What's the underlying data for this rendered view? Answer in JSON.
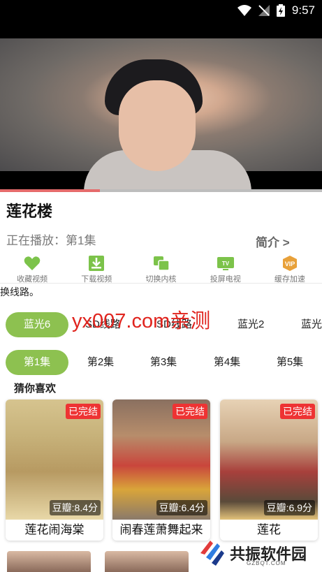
{
  "status": {
    "time": "9:57"
  },
  "player": {
    "progress": 0.31
  },
  "title": "莲花楼",
  "now_playing": "正在播放：第1集",
  "intro": "简介 >",
  "actions": [
    {
      "label": "收藏视频",
      "icon": "heart-icon"
    },
    {
      "label": "下载视频",
      "icon": "download-icon"
    },
    {
      "label": "切换内核",
      "icon": "switch-core-icon"
    },
    {
      "label": "投屏电视",
      "icon": "tv-icon"
    },
    {
      "label": "缓存加速",
      "icon": "vip-icon"
    }
  ],
  "marquee": "换线路。",
  "lines": [
    "蓝光6",
    "SD线路",
    "SD线路",
    "蓝光2",
    "蓝光"
  ],
  "watermark": "yx007.com亲测",
  "episodes": [
    "第1集",
    "第2集",
    "第3集",
    "第4集",
    "第5集"
  ],
  "section_title": "猜你喜欢",
  "recommendations": [
    {
      "name": "莲花闹海棠",
      "badge": "已完结",
      "score": "豆瓣:8.4分"
    },
    {
      "name": "闹春莲萧舞起来",
      "badge": "已完结",
      "score": "豆瓣:6.4分"
    },
    {
      "name": "莲花",
      "badge": "已完结",
      "score": "豆瓣:6.9分"
    }
  ],
  "site_logo": {
    "name": "共振软件园",
    "domain": "GZBQT.COM"
  },
  "colors": {
    "accent": "#8dc150",
    "badge": "#e33333",
    "watermark": "#e0241e"
  }
}
